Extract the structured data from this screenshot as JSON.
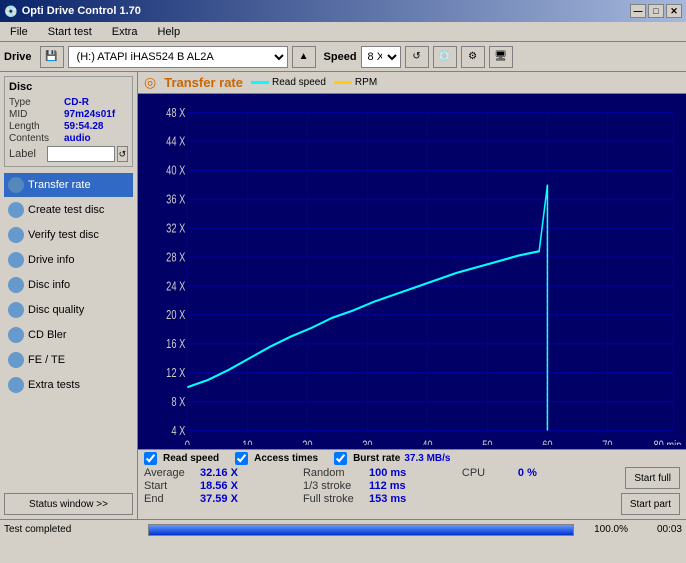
{
  "app": {
    "title": "Opti Drive Control 1.70",
    "title_icon": "disc-icon"
  },
  "title_buttons": {
    "minimize": "—",
    "maximize": "□",
    "close": "✕"
  },
  "menu": {
    "items": [
      "File",
      "Start test",
      "Extra",
      "Help"
    ]
  },
  "toolbar": {
    "drive_label": "Drive",
    "drive_value": "(H:)  ATAPI iHAS524   B AL2A",
    "speed_label": "Speed",
    "speed_value": "8 X"
  },
  "disc": {
    "section_title": "Disc",
    "fields": [
      {
        "label": "Type",
        "value": "CD-R"
      },
      {
        "label": "MID",
        "value": "97m24s01f"
      },
      {
        "label": "Length",
        "value": "59:54.28"
      },
      {
        "label": "Contents",
        "value": "audio"
      },
      {
        "label": "Label",
        "value": ""
      }
    ]
  },
  "nav": {
    "items": [
      {
        "id": "transfer-rate",
        "label": "Transfer rate",
        "active": true
      },
      {
        "id": "create-test-disc",
        "label": "Create test disc",
        "active": false
      },
      {
        "id": "verify-test-disc",
        "label": "Verify test disc",
        "active": false
      },
      {
        "id": "drive-info",
        "label": "Drive info",
        "active": false
      },
      {
        "id": "disc-info",
        "label": "Disc info",
        "active": false
      },
      {
        "id": "disc-quality",
        "label": "Disc quality",
        "active": false
      },
      {
        "id": "cd-bler",
        "label": "CD Bler",
        "active": false
      },
      {
        "id": "fe-te",
        "label": "FE / TE",
        "active": false
      },
      {
        "id": "extra-tests",
        "label": "Extra tests",
        "active": false
      }
    ],
    "status_window": "Status window >>"
  },
  "chart": {
    "title": "Transfer rate",
    "legend": [
      {
        "label": "Read speed",
        "color": "#00ffff"
      },
      {
        "label": "RPM",
        "color": "#ffcc00"
      }
    ],
    "y_axis": [
      "48 X",
      "44 X",
      "40 X",
      "36 X",
      "32 X",
      "28 X",
      "24 X",
      "20 X",
      "16 X",
      "12 X",
      "8 X",
      "4 X"
    ],
    "x_axis": [
      "0",
      "10",
      "20",
      "30",
      "40",
      "50",
      "60",
      "70",
      "80 min"
    ]
  },
  "stats": {
    "checkboxes": [
      {
        "label": "Read speed",
        "checked": true
      },
      {
        "label": "Access times",
        "checked": true
      },
      {
        "label": "Burst rate",
        "checked": true,
        "value": "37.3 MB/s"
      }
    ],
    "rows": [
      {
        "label": "Average",
        "value": "32.16 X",
        "label2": "Random",
        "value2": "100 ms",
        "label3": "CPU",
        "value3": "0 %"
      },
      {
        "label": "Start",
        "value": "18.56 X",
        "label2": "1/3 stroke",
        "value2": "112 ms",
        "label3": "",
        "value3": ""
      },
      {
        "label": "End",
        "value": "37.59 X",
        "label2": "Full stroke",
        "value2": "153 ms",
        "label3": "",
        "value3": ""
      }
    ],
    "buttons": [
      "Start full",
      "Start part"
    ]
  },
  "status_bar": {
    "text": "Test completed",
    "progress": 100,
    "progress_text": "100.0%",
    "time": "00:03"
  }
}
